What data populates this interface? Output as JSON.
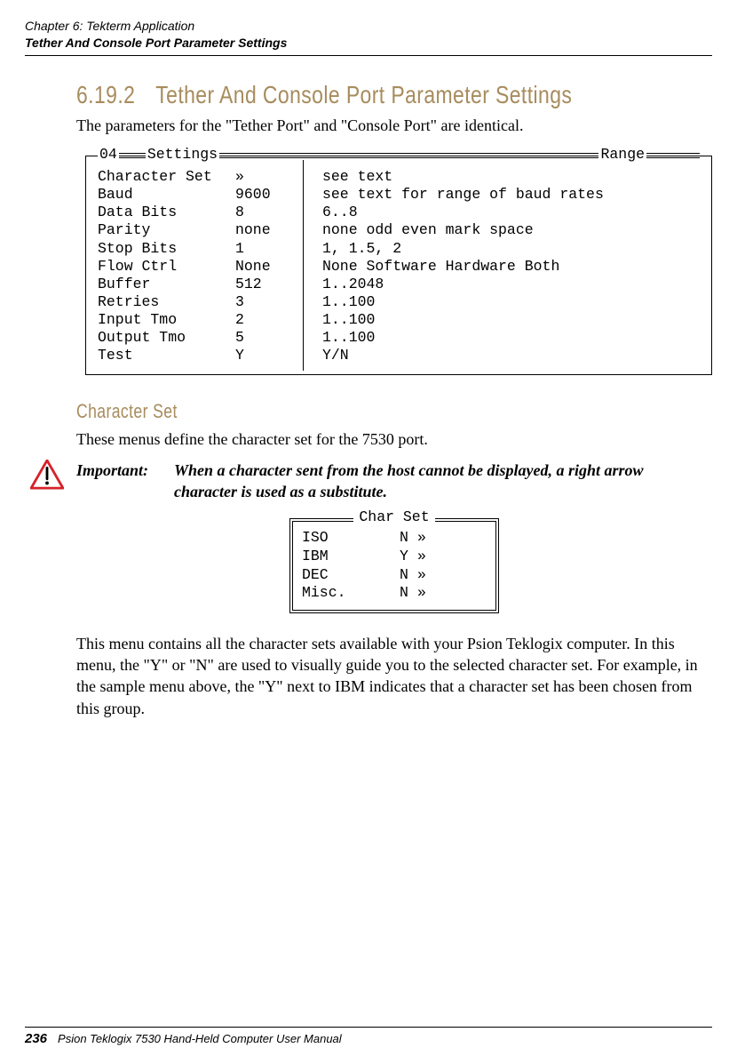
{
  "header": {
    "chapter": "Chapter 6: Tekterm Application",
    "section_title_short": "Tether And Console Port Parameter Settings"
  },
  "section": {
    "number": "6.19.2",
    "title": "Tether And Console Port Parameter Settings",
    "intro": "The parameters for the \"Tether Port\" and \"Console Port\" are identical."
  },
  "settings_box": {
    "top_num": "04",
    "label_settings": "Settings",
    "label_range": "Range",
    "rows": [
      {
        "name": "Character Set",
        "value": "»",
        "range": "see text"
      },
      {
        "name": "Baud",
        "value": "9600",
        "range": "see text for range of baud rates"
      },
      {
        "name": "Data Bits",
        "value": "8",
        "range": "6..8"
      },
      {
        "name": "Parity",
        "value": "none",
        "range": "none odd even mark space"
      },
      {
        "name": "Stop Bits",
        "value": "1",
        "range": "1, 1.5, 2"
      },
      {
        "name": "Flow Ctrl",
        "value": "None",
        "range": "None Software Hardware Both"
      },
      {
        "name": "Buffer",
        "value": "512",
        "range": "1..2048"
      },
      {
        "name": "Retries",
        "value": "3",
        "range": "1..100"
      },
      {
        "name": "Input Tmo",
        "value": "2",
        "range": "1..100"
      },
      {
        "name": "Output Tmo",
        "value": "5",
        "range": "1..100"
      },
      {
        "name": "Test",
        "value": "Y",
        "range": "Y/N"
      }
    ]
  },
  "charset": {
    "heading": "Character Set",
    "intro": "These menus define the character set for the 7530 port.",
    "important_label": "Important:",
    "important_body": "When a character sent from the host cannot be displayed, a right arrow character is used as a substitute.",
    "box_title": "Char Set",
    "rows": [
      {
        "name": "ISO",
        "val": "N",
        "arrow": "»"
      },
      {
        "name": "IBM",
        "val": "Y",
        "arrow": "»"
      },
      {
        "name": "DEC",
        "val": "N",
        "arrow": "»"
      },
      {
        "name": "Misc.",
        "val": "N",
        "arrow": "»"
      }
    ],
    "paragraph": "This menu contains all the character sets available with your Psion Teklogix computer. In this menu, the \"Y\" or \"N\" are used to visually guide you to the selected character set. For example, in the sample menu above, the \"Y\" next to IBM indicates that a character set has been chosen from this group."
  },
  "footer": {
    "page": "236",
    "manual": "Psion Teklogix 7530 Hand-Held Computer User Manual"
  }
}
